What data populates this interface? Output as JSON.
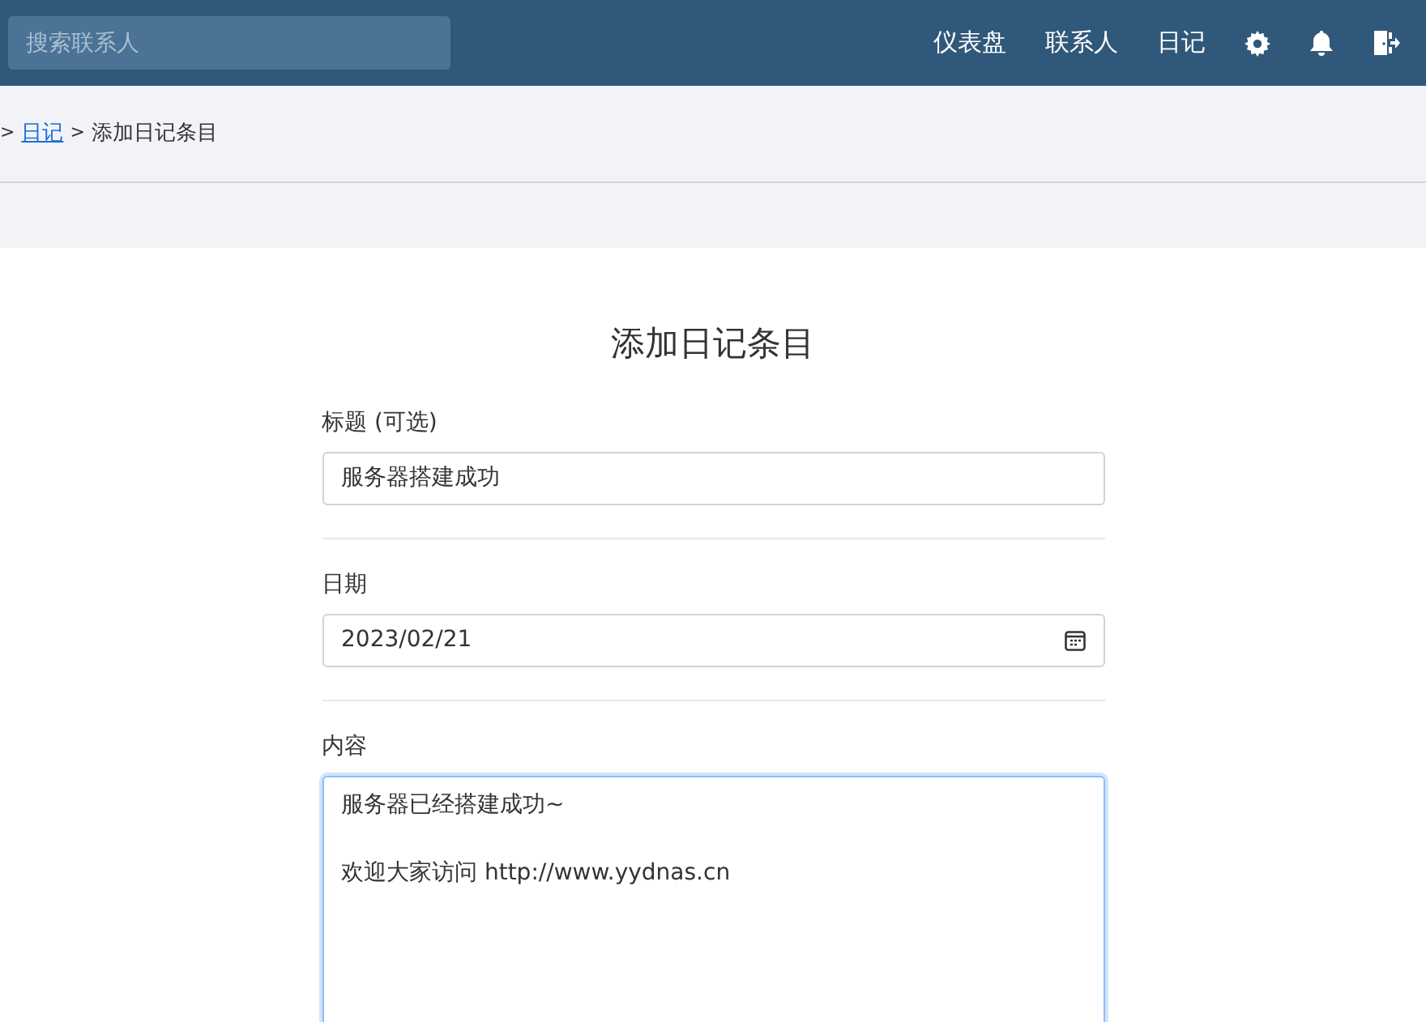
{
  "navbar": {
    "search": {
      "placeholder": "搜索联系人"
    },
    "links": [
      "仪表盘",
      "联系人",
      "日记"
    ],
    "icons": [
      {
        "kind": "settings"
      },
      {
        "kind": "bell"
      },
      {
        "kind": "logout"
      }
    ]
  },
  "breadcrumb": [
    {
      "kind": "sep",
      "text": ">"
    },
    {
      "kind": "link",
      "text": "日记"
    },
    {
      "kind": "sep",
      "text": ">"
    },
    {
      "kind": "text",
      "text": "添加日记条目"
    }
  ],
  "form": {
    "heading": "添加日记条目",
    "fields": [
      {
        "kind": "text",
        "label": "标题 (可选)",
        "value": "服务器搭建成功",
        "focused": false
      },
      {
        "kind": "date",
        "label": "日期",
        "value": "2023/02/21",
        "focused": false
      },
      {
        "kind": "textarea",
        "label": "内容",
        "value": "服务器已经搭建成功~\n\n欢迎大家访问 http://www.yydnas.cn",
        "focused": true
      }
    ]
  }
}
